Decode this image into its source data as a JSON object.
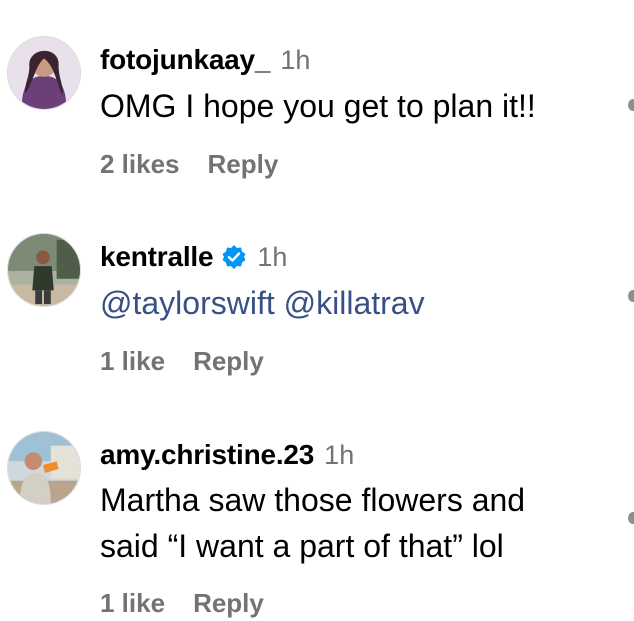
{
  "comments": [
    {
      "username": "fotojunkaay_",
      "time": "1h",
      "verified": false,
      "text": "OMG I hope you get to plan it!!",
      "likes": "2 likes",
      "reply": "Reply"
    },
    {
      "username": "kentralle",
      "time": "1h",
      "verified": true,
      "mentions": [
        "@taylorswift",
        "@killatrav"
      ],
      "likes": "1 like",
      "reply": "Reply"
    },
    {
      "username": "amy.christine.23",
      "time": "1h",
      "verified": false,
      "text_lines": [
        "Martha saw those flowers and",
        "said “I want a part of that” lol"
      ],
      "likes": "1 like",
      "reply": "Reply"
    }
  ],
  "colors": {
    "username": "#000000",
    "secondary": "#737373",
    "mention": "#385185",
    "verified_badge": "#0095f6"
  },
  "icons": [
    "verified-badge-icon",
    "heart-icon"
  ]
}
